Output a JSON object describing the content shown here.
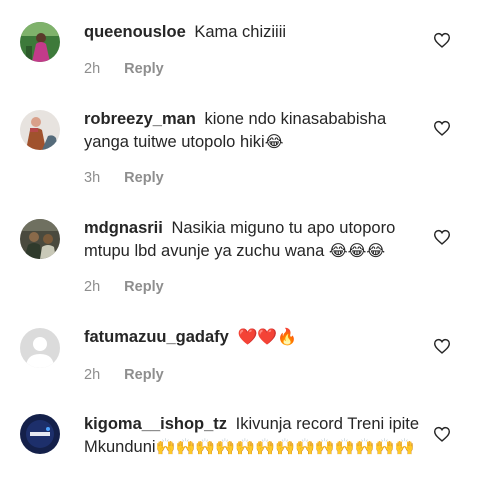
{
  "comments": [
    {
      "username": "queenousloe",
      "text": "Kama chiziiii",
      "emoji": "",
      "time": "2h",
      "reply_label": "Reply",
      "like_icon": "heart-outline-icon"
    },
    {
      "username": "robreezy_man",
      "text": "kione ndo kinasababisha yanga tuitwe utopolo hiki",
      "emoji": "😂",
      "time": "3h",
      "reply_label": "Reply",
      "like_icon": "heart-outline-icon"
    },
    {
      "username": "mdgnasrii",
      "text": "Nasikia miguno tu apo utoporo mtupu lbd avunje ya zuchu wana",
      "emoji": "😂😂😂",
      "time": "2h",
      "reply_label": "Reply",
      "like_icon": "heart-outline-icon"
    },
    {
      "username": "fatumazuu_gadafy",
      "text": "",
      "emoji": "❤️❤️🔥",
      "time": "2h",
      "reply_label": "Reply",
      "like_icon": "heart-outline-icon"
    },
    {
      "username": "kigoma__ishop_tz",
      "text": "Ikivunja record Treni ipite Mkunduni",
      "emoji": "🙌🙌🙌🙌🙌🙌🙌🙌🙌🙌🙌🙌🙌",
      "time": "",
      "reply_label": "",
      "like_icon": "heart-outline-icon"
    }
  ],
  "colors": {
    "text": "#262626",
    "muted": "#8e8e8e",
    "background": "#ffffff"
  }
}
